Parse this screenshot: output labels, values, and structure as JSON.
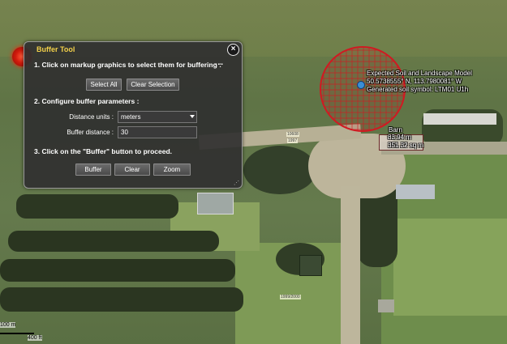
{
  "panel": {
    "title": "Buffer Tool",
    "close_icon": "close-icon",
    "step1": "1. Click on markup graphics to select them for buffering :",
    "menu": "...",
    "select_all": "Select All",
    "clear_selection": "Clear Selection",
    "step2": "2. Configure buffer parameters :",
    "distance_units_label": "Distance units :",
    "distance_units_value": "meters",
    "buffer_distance_label": "Buffer distance :",
    "buffer_distance_value": "30",
    "step3": "3. Click on the \"Buffer\" button to proceed.",
    "buffer_btn": "Buffer",
    "clear_btn": "Clear",
    "zoom_btn": "Zoom"
  },
  "annotation": {
    "line1": "Expected Soil and Landscape Model",
    "line2": "50.5738555° N, 113.7980081° W",
    "line3": "Generated soil symbol: LTM01 U1h"
  },
  "barn": {
    "title": "Barn",
    "length": "83.94 m",
    "area": "351.32 sq m"
  },
  "tiny_labels": {
    "a": "10608",
    "b": "1997",
    "c": "1999/2000"
  },
  "scale": {
    "metric": "100 m",
    "imperial": "400 ft"
  },
  "colors": {
    "buffer": "#d01a22",
    "panel_title": "#f2d04a"
  }
}
